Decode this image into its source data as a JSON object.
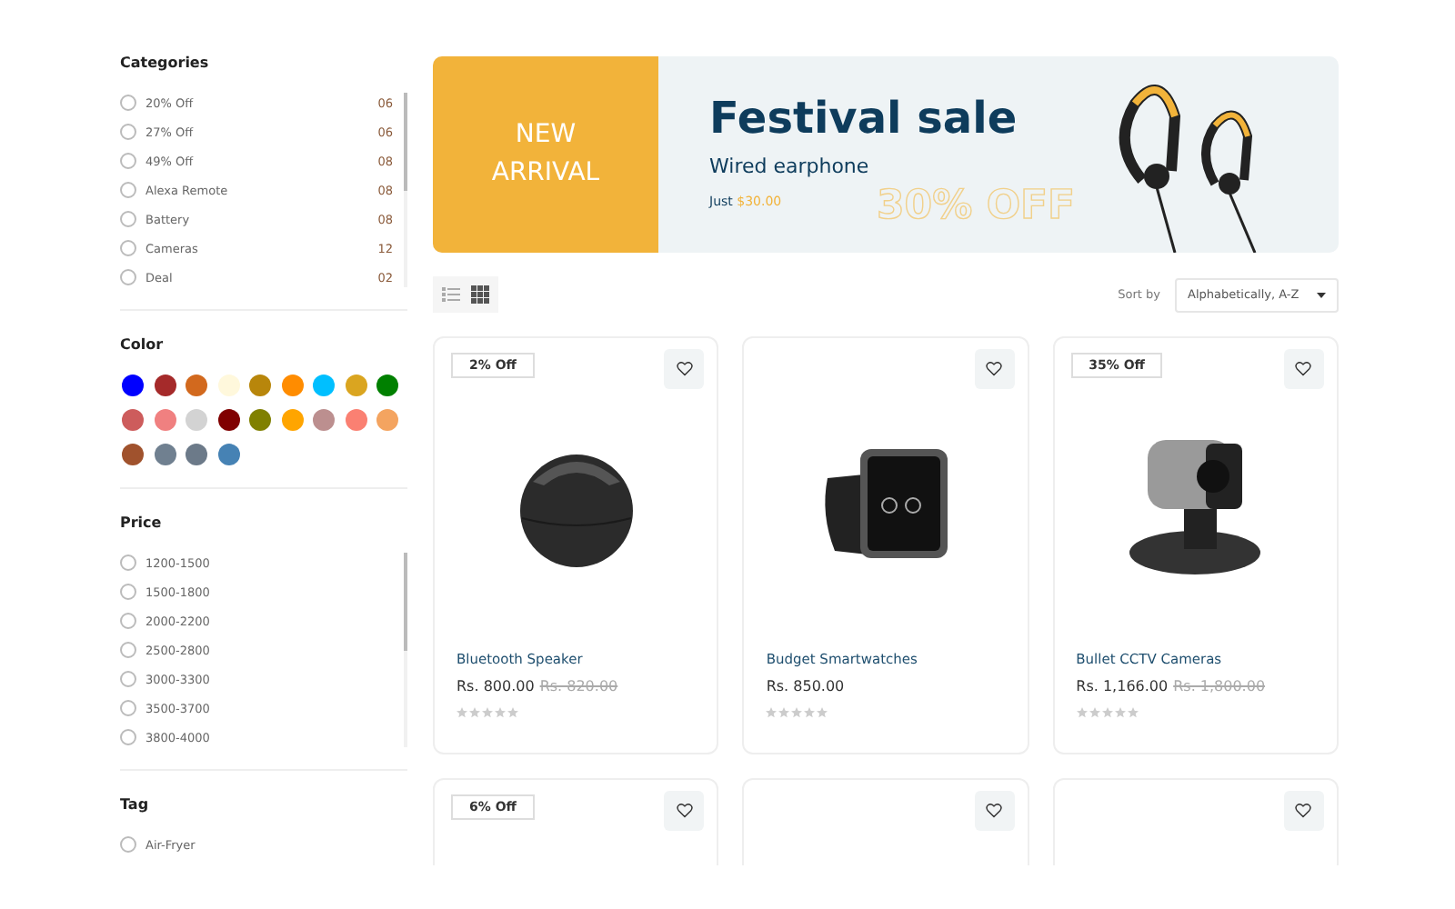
{
  "sidebar": {
    "categories": {
      "title": "Categories",
      "items": [
        {
          "label": "20% Off",
          "count": "06",
          "checked": false
        },
        {
          "label": "27% Off",
          "count": "06",
          "checked": false
        },
        {
          "label": "49% Off",
          "count": "08",
          "checked": false
        },
        {
          "label": "Alexa Remote",
          "count": "08",
          "checked": false
        },
        {
          "label": "Battery",
          "count": "08",
          "checked": false
        },
        {
          "label": "Cameras",
          "count": "12",
          "checked": false
        },
        {
          "label": "Deal",
          "count": "02",
          "checked": false
        }
      ]
    },
    "color": {
      "title": "Color",
      "swatches": [
        {
          "color": "#0000ff"
        },
        {
          "color": "#a52a2a"
        },
        {
          "color": "#d2691e"
        },
        {
          "color": "#fff8dc"
        },
        {
          "color": "#b8860b"
        },
        {
          "color": "#ff8c00"
        },
        {
          "color": "#00bfff"
        },
        {
          "color": "#daa520"
        },
        {
          "color": "#008000"
        },
        {
          "color": "#cd5c5c"
        },
        {
          "color": "#f08080"
        },
        {
          "color": "#d3d3d3"
        },
        {
          "color": "#800000"
        },
        {
          "color": "#808000"
        },
        {
          "color": "#ffa500"
        },
        {
          "color": "#bc8f8f"
        },
        {
          "color": "#fa8072"
        },
        {
          "color": "#f4a460"
        },
        {
          "color": "#a0522d"
        },
        {
          "color": "#708090"
        },
        {
          "color": "#6c7a89"
        },
        {
          "color": "#4682b4"
        }
      ]
    },
    "price": {
      "title": "Price",
      "items": [
        {
          "label": "1200-1500",
          "checked": false
        },
        {
          "label": "1500-1800",
          "checked": false
        },
        {
          "label": "2000-2200",
          "checked": false
        },
        {
          "label": "2500-2800",
          "checked": false
        },
        {
          "label": "3000-3300",
          "checked": false
        },
        {
          "label": "3500-3700",
          "checked": false
        },
        {
          "label": "3800-4000",
          "checked": false
        }
      ]
    },
    "tag": {
      "title": "Tag",
      "items": [
        {
          "label": "Air-Fryer",
          "checked": false
        }
      ]
    }
  },
  "banner": {
    "badge_line_1": "NEW",
    "badge_line_2": "ARRIVAL",
    "title": "Festival sale",
    "subtitle": "Wired earphone",
    "price_prefix": "Just",
    "price": "$30.00",
    "discount": "30% OFF"
  },
  "toolbar": {
    "views": [
      {
        "kind": "list",
        "selected": false
      },
      {
        "kind": "grid",
        "selected": true
      }
    ],
    "sort_label": "Sort by",
    "sort_value": "Alphabetically, A-Z"
  },
  "products": [
    {
      "kind": "speaker",
      "badge": "2% Off",
      "name": "Bluetooth Speaker",
      "price": "Rs. 800.00",
      "old_price": "Rs. 820.00",
      "stars": 0
    },
    {
      "kind": "watch",
      "name": "Budget Smartwatches",
      "price": "Rs. 850.00",
      "stars": 0
    },
    {
      "kind": "camera",
      "badge": "35% Off",
      "name": "Bullet CCTV Cameras",
      "price": "Rs. 1,166.00",
      "old_price": "Rs. 1,800.00",
      "stars": 0
    },
    {
      "kind": "none",
      "badge": "6% Off"
    },
    {
      "kind": "none"
    },
    {
      "kind": "none"
    }
  ]
}
